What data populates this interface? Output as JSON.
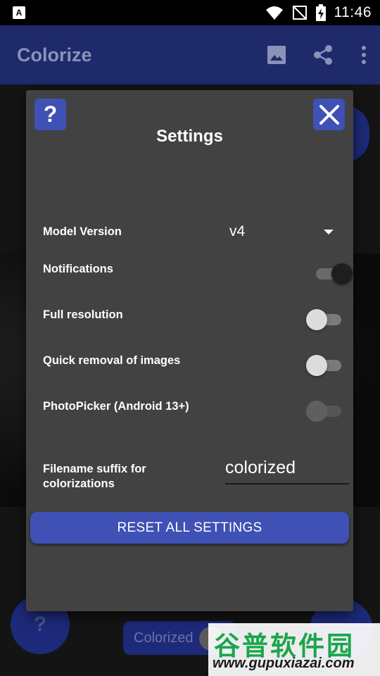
{
  "status_bar": {
    "time": "11:46",
    "app_icon_letter": "A"
  },
  "app_bar": {
    "title": "Colorize",
    "actions": [
      {
        "name": "image-icon"
      },
      {
        "name": "share-icon"
      },
      {
        "name": "more-vert-icon"
      }
    ]
  },
  "background": {
    "help_fab_label": "?",
    "colorized_chip_label": "Colorized"
  },
  "dialog": {
    "title": "Settings",
    "help_button_label": "?",
    "settings": {
      "model_version": {
        "label": "Model Version",
        "value": "v4"
      },
      "notifications": {
        "label": "Notifications",
        "state": "on"
      },
      "full_resolution": {
        "label": "Full resolution",
        "state": "off"
      },
      "quick_removal": {
        "label": "Quick removal of images",
        "state": "off"
      },
      "photo_picker": {
        "label": "PhotoPicker (Android 13+)",
        "state": "disabled"
      },
      "filename_suffix": {
        "label_line1": "Filename suffix for",
        "label_line2": "colorizations",
        "value": "colorized"
      }
    },
    "reset_button_label": "RESET ALL SETTINGS"
  },
  "watermark": {
    "text": "谷普软件园",
    "url": "www.gupuxiazai.com"
  }
}
